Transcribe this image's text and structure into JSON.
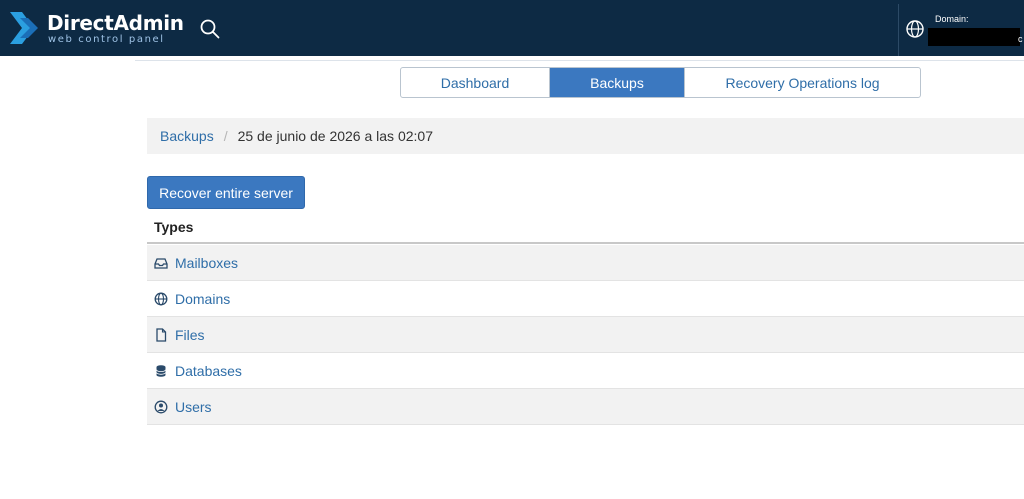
{
  "header": {
    "brand_name": "DirectAdmin",
    "brand_tagline": "web control panel",
    "domain_label": "Domain:",
    "domain_tail": "c"
  },
  "tabs": [
    {
      "label": "Dashboard",
      "active": false
    },
    {
      "label": "Backups",
      "active": true
    },
    {
      "label": "Recovery Operations log",
      "active": false
    }
  ],
  "breadcrumb": {
    "parent": "Backups",
    "separator": "/",
    "current": "25 de junio de 2026 a las 02:07"
  },
  "actions": {
    "recover_label": "Recover entire server"
  },
  "types": {
    "header": "Types",
    "items": [
      {
        "label": "Mailboxes",
        "icon": "inbox-icon"
      },
      {
        "label": "Domains",
        "icon": "globe-icon"
      },
      {
        "label": "Files",
        "icon": "file-icon"
      },
      {
        "label": "Databases",
        "icon": "database-icon"
      },
      {
        "label": "Users",
        "icon": "user-circle-icon"
      }
    ]
  },
  "colors": {
    "topbar": "#0d2a44",
    "accent": "#3b78c0",
    "link": "#2f6ea8",
    "logo_light": "#2b9fe0",
    "logo_dark": "#1b6fb8"
  }
}
